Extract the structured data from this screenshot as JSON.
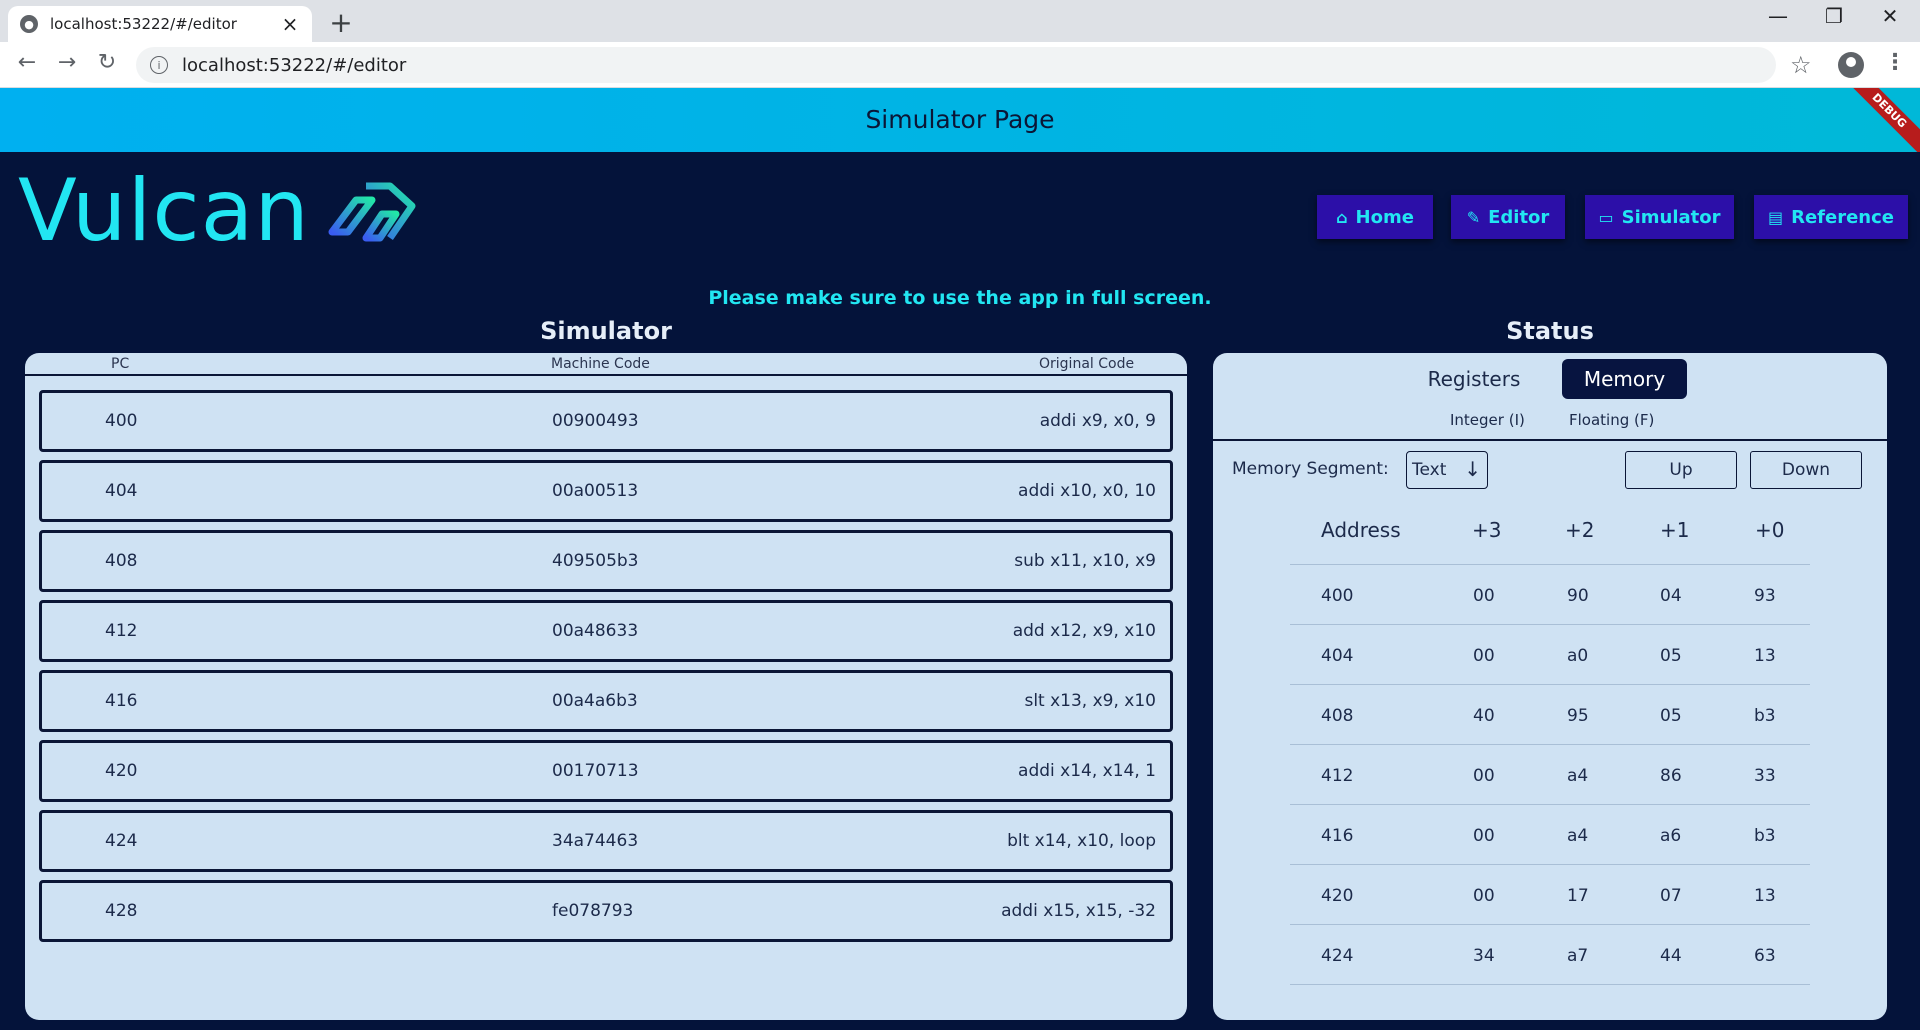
{
  "browser": {
    "tab_title": "localhost:53222/#/editor",
    "url": "localhost:53222/#/editor"
  },
  "appbar": {
    "title": "Simulator Page",
    "debug_badge": "DEBUG"
  },
  "logo": {
    "text": "Vulcan"
  },
  "nav": {
    "home": "Home",
    "editor": "Editor",
    "simulator": "Simulator",
    "reference": "Reference"
  },
  "notice": "Please make sure to use the app in full screen.",
  "simulator": {
    "title": "Simulator",
    "columns": {
      "pc": "PC",
      "machine_code": "Machine Code",
      "original_code": "Original Code"
    },
    "rows": [
      {
        "pc": "400",
        "machine": "00900493",
        "original": "addi x9, x0, 9"
      },
      {
        "pc": "404",
        "machine": "00a00513",
        "original": "addi x10, x0, 10"
      },
      {
        "pc": "408",
        "machine": "409505b3",
        "original": "sub x11, x10, x9"
      },
      {
        "pc": "412",
        "machine": "00a48633",
        "original": "add x12, x9, x10"
      },
      {
        "pc": "416",
        "machine": "00a4a6b3",
        "original": "slt x13, x9, x10"
      },
      {
        "pc": "420",
        "machine": "00170713",
        "original": "addi x14, x14, 1"
      },
      {
        "pc": "424",
        "machine": "34a74463",
        "original": "blt x14, x10, loop"
      },
      {
        "pc": "428",
        "machine": "fe078793",
        "original": "addi x15, x15, -32"
      }
    ]
  },
  "status": {
    "title": "Status",
    "tabs": {
      "registers": "Registers",
      "memory": "Memory"
    },
    "active_tab": "Memory",
    "subtabs": {
      "integer": "Integer (I)",
      "floating": "Floating (F)"
    },
    "segment_label": "Memory Segment:",
    "segment_value": "Text",
    "up": "Up",
    "down": "Down",
    "columns": {
      "address": "Address",
      "b3": "+3",
      "b2": "+2",
      "b1": "+1",
      "b0": "+0"
    },
    "rows": [
      {
        "address": "400",
        "b3": "00",
        "b2": "90",
        "b1": "04",
        "b0": "93"
      },
      {
        "address": "404",
        "b3": "00",
        "b2": "a0",
        "b1": "05",
        "b0": "13"
      },
      {
        "address": "408",
        "b3": "40",
        "b2": "95",
        "b1": "05",
        "b0": "b3"
      },
      {
        "address": "412",
        "b3": "00",
        "b2": "a4",
        "b1": "86",
        "b0": "33"
      },
      {
        "address": "416",
        "b3": "00",
        "b2": "a4",
        "b1": "a6",
        "b0": "b3"
      },
      {
        "address": "420",
        "b3": "00",
        "b2": "17",
        "b1": "07",
        "b0": "13"
      },
      {
        "address": "424",
        "b3": "34",
        "b2": "a7",
        "b1": "44",
        "b0": "63"
      }
    ]
  }
}
